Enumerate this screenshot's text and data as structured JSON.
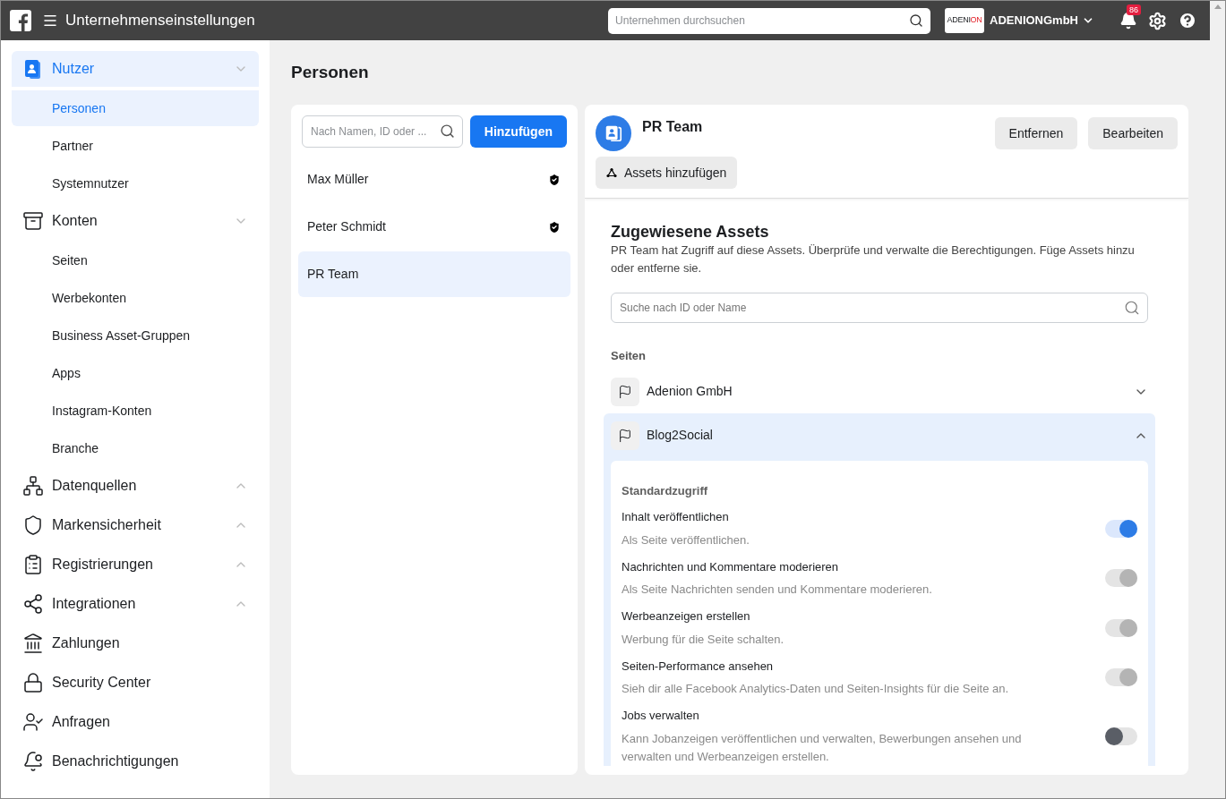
{
  "header": {
    "title": "Unternehmenseinstellungen",
    "search": {
      "placeholder": "Unternehmen durchsuchen"
    },
    "business": {
      "logo_text": "ADENI",
      "logo_text_2": "ON",
      "name": "ADENIONGmbH"
    },
    "notifications": "86"
  },
  "sidebar": {
    "sections": [
      {
        "label": "Nutzer",
        "selected": true,
        "expanded": true,
        "children": [
          {
            "label": "Personen",
            "selected": true
          },
          {
            "label": "Partner",
            "selected": false
          },
          {
            "label": "Systemnutzer",
            "selected": false
          }
        ]
      },
      {
        "label": "Konten",
        "selected": false,
        "expanded": true,
        "children": [
          {
            "label": "Seiten",
            "selected": false
          },
          {
            "label": "Werbekonten",
            "selected": false
          },
          {
            "label": "Business Asset-Gruppen",
            "selected": false
          },
          {
            "label": "Apps",
            "selected": false
          },
          {
            "label": "Instagram-Konten",
            "selected": false
          },
          {
            "label": "Branche",
            "selected": false
          }
        ]
      },
      {
        "label": "Datenquellen",
        "selected": false,
        "expanded": false
      },
      {
        "label": "Markensicherheit",
        "selected": false,
        "expanded": false
      },
      {
        "label": "Registrierungen",
        "selected": false,
        "expanded": false
      },
      {
        "label": "Integrationen",
        "selected": false,
        "expanded": false
      },
      {
        "label": "Zahlungen",
        "selected": false
      },
      {
        "label": "Security Center",
        "selected": false
      },
      {
        "label": "Anfragen",
        "selected": false
      },
      {
        "label": "Benachrichtigungen",
        "selected": false
      }
    ]
  },
  "page_title": "Personen",
  "people_panel": {
    "search": {
      "placeholder": "Nach Namen, ID oder ..."
    },
    "add_button": "Hinzufügen",
    "people": [
      {
        "name": "Max Müller",
        "admin": true,
        "selected": false
      },
      {
        "name": "Peter Schmidt",
        "admin": true,
        "selected": false
      },
      {
        "name": "PR Team",
        "admin": false,
        "selected": true
      }
    ]
  },
  "detail": {
    "name": "PR Team",
    "buttons": [
      "Entfernen",
      "Bearbeiten"
    ],
    "add_assets": "Assets hinzufügen",
    "assets_title": "Zugewiesene Assets",
    "assets_description": "PR Team hat Zugriff auf diese Assets. Überprüfe und verwalte die Berechtigungen. Füge Assets hinzu oder entferne sie.",
    "search": {
      "placeholder": "Suche nach ID oder Name"
    },
    "group_label": "Seiten",
    "pages": [
      {
        "name": "Adenion GmbH",
        "expanded": false
      },
      {
        "name": "Blog2Social",
        "expanded": true
      }
    ],
    "access_title": "Standardzugriff",
    "permissions": [
      {
        "title": "Inhalt veröffentlichen",
        "description": "Als Seite veröffentlichen.",
        "on": true,
        "disabled": false
      },
      {
        "title": "Nachrichten und Kommentare moderieren",
        "description": "Als Seite Nachrichten senden und Kommentare moderieren.",
        "on": true,
        "disabled": true
      },
      {
        "title": "Werbeanzeigen erstellen",
        "description": "Werbung für die Seite schalten.",
        "on": true,
        "disabled": true
      },
      {
        "title": "Seiten-Performance ansehen",
        "description": "Sieh dir alle Facebook Analytics-Daten und Seiten-Insights für die Seite an.",
        "on": true,
        "disabled": true
      },
      {
        "title": "Jobs verwalten",
        "description": "Kann Jobanzeigen veröffentlichen und verwalten, Bewerbungen ansehen und verwalten und Werbeanzeigen erstellen.",
        "on": false,
        "disabled": false
      }
    ]
  }
}
